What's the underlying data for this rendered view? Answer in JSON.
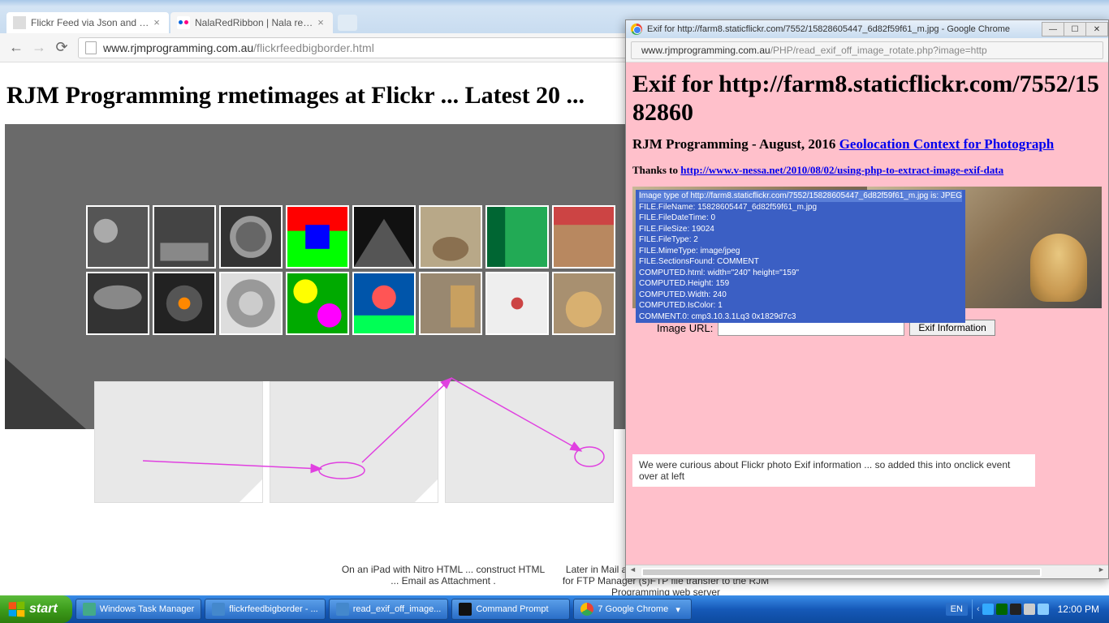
{
  "tabs": [
    {
      "title": "Flickr Feed via Json and jQu"
    },
    {
      "title": "NalaRedRibbon | Nala ready"
    }
  ],
  "url": {
    "domain": "www.rjmprogramming.com.au",
    "path": "/flickrfeedbigborder.html"
  },
  "page": {
    "heading": "RJM Programming rmetimages at Flickr ... Latest 20 ...",
    "caption_left": "On an iPad with Nitro HTML ... construct HTML ... Email as Attachment .",
    "caption_right": "Later in Mail app use Attachment Share option for FTP Manager (s)FTP file transfer to the RJM Programming web server"
  },
  "sw": {
    "title": "Exif for http://farm8.staticflickr.com/7552/15828605447_6d82f59f61_m.jpg - Google Chrome",
    "url_domain": "www.rjmprogramming.com.au",
    "url_path": "/PHP/read_exif_off_image_rotate.php?image=http",
    "heading": "Exif for http://farm8.staticflickr.com/7552/1582860",
    "sub_prefix": "RJM Programming - August, 2016 ",
    "sub_link": "Geolocation Context for Photograph",
    "thanks_prefix": "Thanks to ",
    "thanks_link": "http://www.v-nessa.net/2010/08/02/using-php-to-extract-image-exif-data",
    "exif": [
      "Image type of http://farm8.staticflickr.com/7552/15828605447_6d82f59f61_m.jpg is: JPEG",
      "FILE.FileName: 15828605447_6d82f59f61_m.jpg",
      "FILE.FileDateTime: 0",
      "FILE.FileSize: 19024",
      "FILE.FileType: 2",
      "FILE.MimeType: image/jpeg",
      "FILE.SectionsFound: COMMENT",
      "COMPUTED.html: width=\"240\" height=\"159\"",
      "COMPUTED.Height: 159",
      "COMPUTED.Width: 240",
      "COMPUTED.IsColor: 1",
      "COMMENT.0: cmp3.10.3.1Lq3 0x1829d7c3"
    ],
    "form_label": "Image URL:",
    "form_button": "Exif Information",
    "note": "We were curious about Flickr photo Exif information ... so added this into onclick event over at left"
  },
  "taskbar": {
    "start": "start",
    "items": [
      "Windows Task Manager",
      "flickrfeedbigborder - ...",
      "read_exif_off_image...",
      "Command Prompt",
      "7 Google Chrome"
    ],
    "lang": "EN",
    "clock": "12:00 PM"
  }
}
